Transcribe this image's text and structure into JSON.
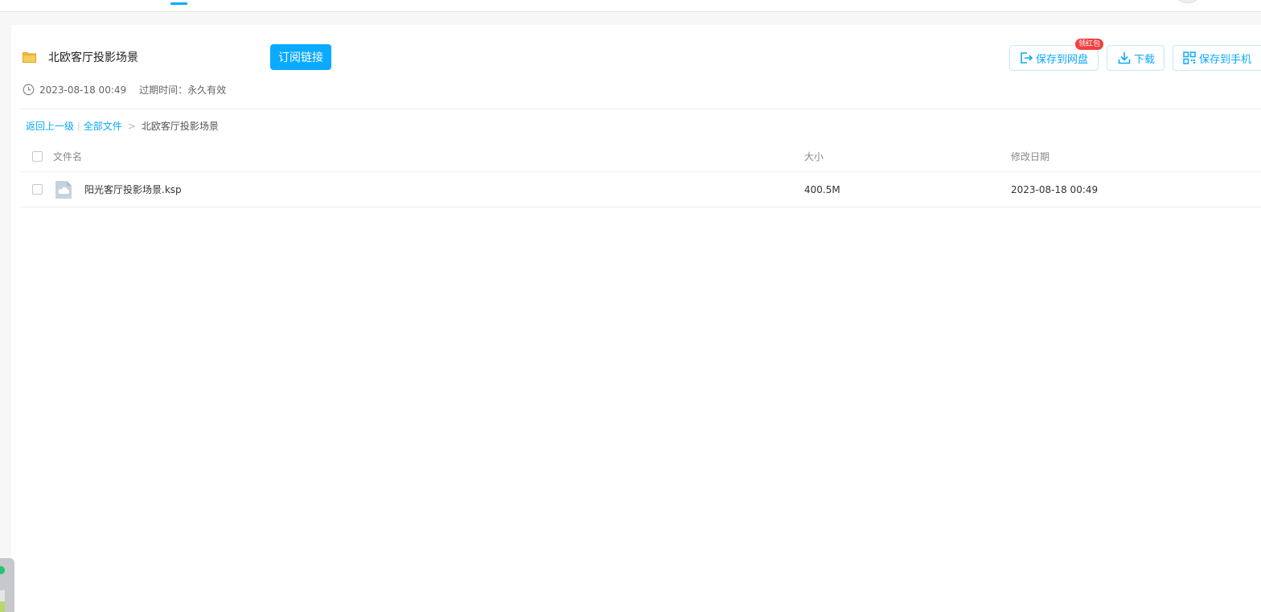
{
  "folder": {
    "title": "北欧客厅投影场景",
    "created": "2023-08-18 00:49",
    "expire_label": "过期时间：永久有效"
  },
  "subscribe_label": "订阅链接",
  "actions": {
    "save_disk": "保存到网盘",
    "badge": "领红包",
    "download": "下载",
    "save_phone": "保存到手机"
  },
  "breadcrumb": {
    "back": "返回上一级",
    "sep_bar": "|",
    "all_files": "全部文件",
    "sep": ">",
    "current": "北欧客厅投影场景"
  },
  "table": {
    "headers": {
      "name": "文件名",
      "size": "大小",
      "date": "修改日期"
    },
    "rows": [
      {
        "name": "阳光客厅投影场景.ksp",
        "size": "400.5M",
        "date": "2023-08-18 00:49"
      }
    ]
  },
  "colors": {
    "accent": "#09aaff",
    "badge": "#f23f3f",
    "folder": "#f5c242"
  }
}
